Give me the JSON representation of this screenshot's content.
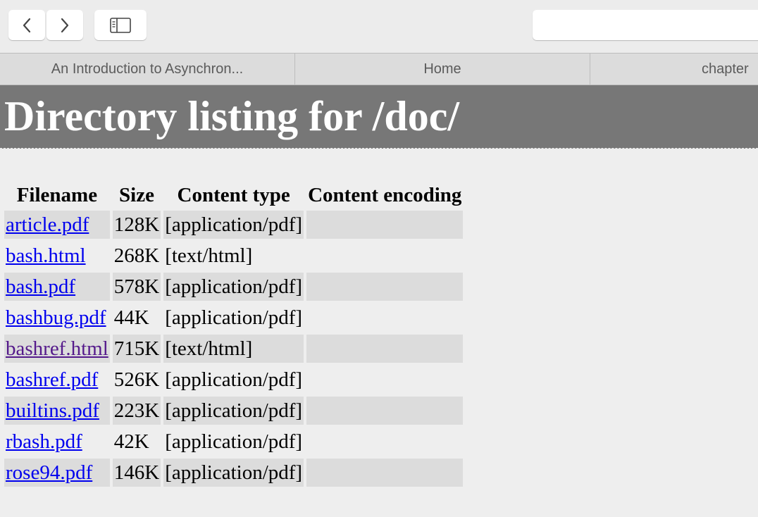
{
  "browser": {
    "tabs": [
      {
        "label": "An Introduction to Asynchron..."
      },
      {
        "label": "Home"
      },
      {
        "label": "chapter"
      }
    ]
  },
  "page": {
    "heading": "Directory listing for /doc/",
    "columns": [
      "Filename",
      "Size",
      "Content type",
      "Content encoding"
    ],
    "files": [
      {
        "name": "article.pdf",
        "size": "128K",
        "type": "[application/pdf]",
        "encoding": ""
      },
      {
        "name": "bash.html",
        "size": "268K",
        "type": "[text/html]",
        "encoding": ""
      },
      {
        "name": "bash.pdf",
        "size": "578K",
        "type": "[application/pdf]",
        "encoding": ""
      },
      {
        "name": "bashbug.pdf",
        "size": "44K",
        "type": "[application/pdf]",
        "encoding": ""
      },
      {
        "name": "bashref.html",
        "size": "715K",
        "type": "[text/html]",
        "encoding": ""
      },
      {
        "name": "bashref.pdf",
        "size": "526K",
        "type": "[application/pdf]",
        "encoding": ""
      },
      {
        "name": "builtins.pdf",
        "size": "223K",
        "type": "[application/pdf]",
        "encoding": ""
      },
      {
        "name": "rbash.pdf",
        "size": "42K",
        "type": "[application/pdf]",
        "encoding": ""
      },
      {
        "name": "rose94.pdf",
        "size": "146K",
        "type": "[application/pdf]",
        "encoding": ""
      }
    ]
  },
  "colors": {
    "link": "#0000ee",
    "visited_link": "#551a8b",
    "banner": "#777777"
  },
  "icons": {
    "back": "chevron-left-icon",
    "forward": "chevron-right-icon",
    "sidebar": "sidebar-icon"
  }
}
